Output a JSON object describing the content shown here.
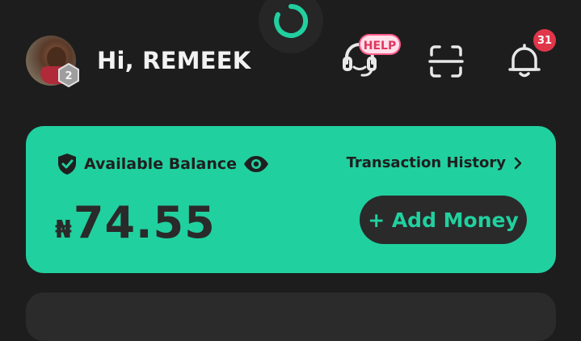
{
  "header": {
    "greeting": "Hi, REMEEK",
    "avatar_badge": "2",
    "help_badge": "HELP",
    "notification_count": "31"
  },
  "balance_card": {
    "label": "Available Balance",
    "transaction_history_label": "Transaction History",
    "currency_symbol": "₦",
    "amount": "74.55",
    "add_money_label": "+ Add Money"
  },
  "icons": {
    "loader": "loading-spinner-icon",
    "help": "headset-icon",
    "scan": "scan-icon",
    "bell": "bell-icon",
    "shield": "shield-check-icon",
    "eye": "eye-icon",
    "chevron": "chevron-right-icon"
  },
  "colors": {
    "background": "#1d1d1d",
    "accent": "#21d09f",
    "card_text": "#2a2a2a",
    "notification": "#e0364a",
    "help_badge": "#ff5a8a"
  }
}
